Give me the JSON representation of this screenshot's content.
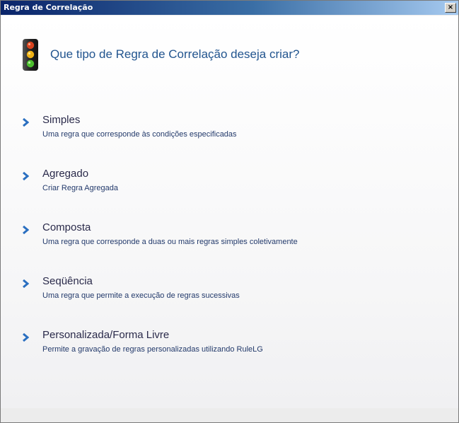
{
  "window": {
    "title": "Regra de Correlação",
    "close_label": "×"
  },
  "heading": "Que tipo de Regra de Correlação deseja criar?",
  "options": [
    {
      "title": "Simples",
      "description": "Uma regra que corresponde às condições especificadas"
    },
    {
      "title": "Agregado",
      "description": "Criar Regra Agregada"
    },
    {
      "title": "Composta",
      "description": "Uma regra que corresponde a duas ou mais regras simples coletivamente"
    },
    {
      "title": "Seqüência",
      "description": "Uma regra que permite a execução de regras sucessivas"
    },
    {
      "title": "Personalizada/Forma Livre",
      "description": "Permite a gravação de regras personalizadas utilizando RuleLG"
    }
  ],
  "icons": {
    "header": "traffic-light-icon",
    "option": "chevron-right-icon"
  },
  "colors": {
    "heading": "#22558f",
    "chevron": "#2a6fc0",
    "titlebar_start": "#0a246a",
    "titlebar_end": "#a6caf0"
  }
}
